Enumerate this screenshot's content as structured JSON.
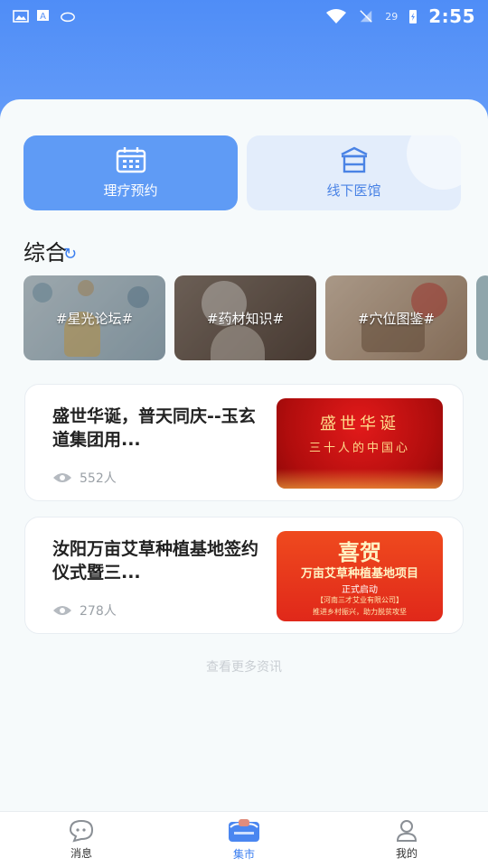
{
  "status_bar": {
    "time": "2:55",
    "battery_percent": "29",
    "icons": [
      "gallery-icon",
      "translate-icon",
      "cloud-icon",
      "wifi-icon",
      "no-sim-icon",
      "battery-charging-icon"
    ]
  },
  "quick_actions": [
    {
      "label": "理疗预约",
      "icon": "calendar-icon"
    },
    {
      "label": "线下医馆",
      "icon": "clinic-icon"
    }
  ],
  "section": {
    "title": "综合"
  },
  "topics": [
    {
      "label": "#星光论坛#"
    },
    {
      "label": "#药材知识#"
    },
    {
      "label": "#穴位图鉴#"
    }
  ],
  "news": [
    {
      "title": "盛世华诞，普天同庆--玉玄道集团用...",
      "views": "552人",
      "thumb_main": "盛世华诞",
      "thumb_sub": "三十人的中国心"
    },
    {
      "title": "汝阳万亩艾草种植基地签约仪式暨三...",
      "views": "278人",
      "thumb_main": "喜贺",
      "thumb_sub": "万亩艾草种植基地项目",
      "thumb_tag": "正式启动",
      "thumb_org": "【河南三才艾业有限公司】",
      "thumb_slogan": "推进乡村振兴，助力脱贫攻坚"
    }
  ],
  "load_more": "查看更多资讯",
  "tabbar": [
    {
      "label": "消息",
      "icon": "chat-icon",
      "active": false
    },
    {
      "label": "集市",
      "icon": "market-icon",
      "active": true
    },
    {
      "label": "我的",
      "icon": "profile-icon",
      "active": false
    }
  ],
  "colors": {
    "primary": "#3a7ef0",
    "header": "#5a93f6",
    "accent_red": "#d6141a"
  }
}
